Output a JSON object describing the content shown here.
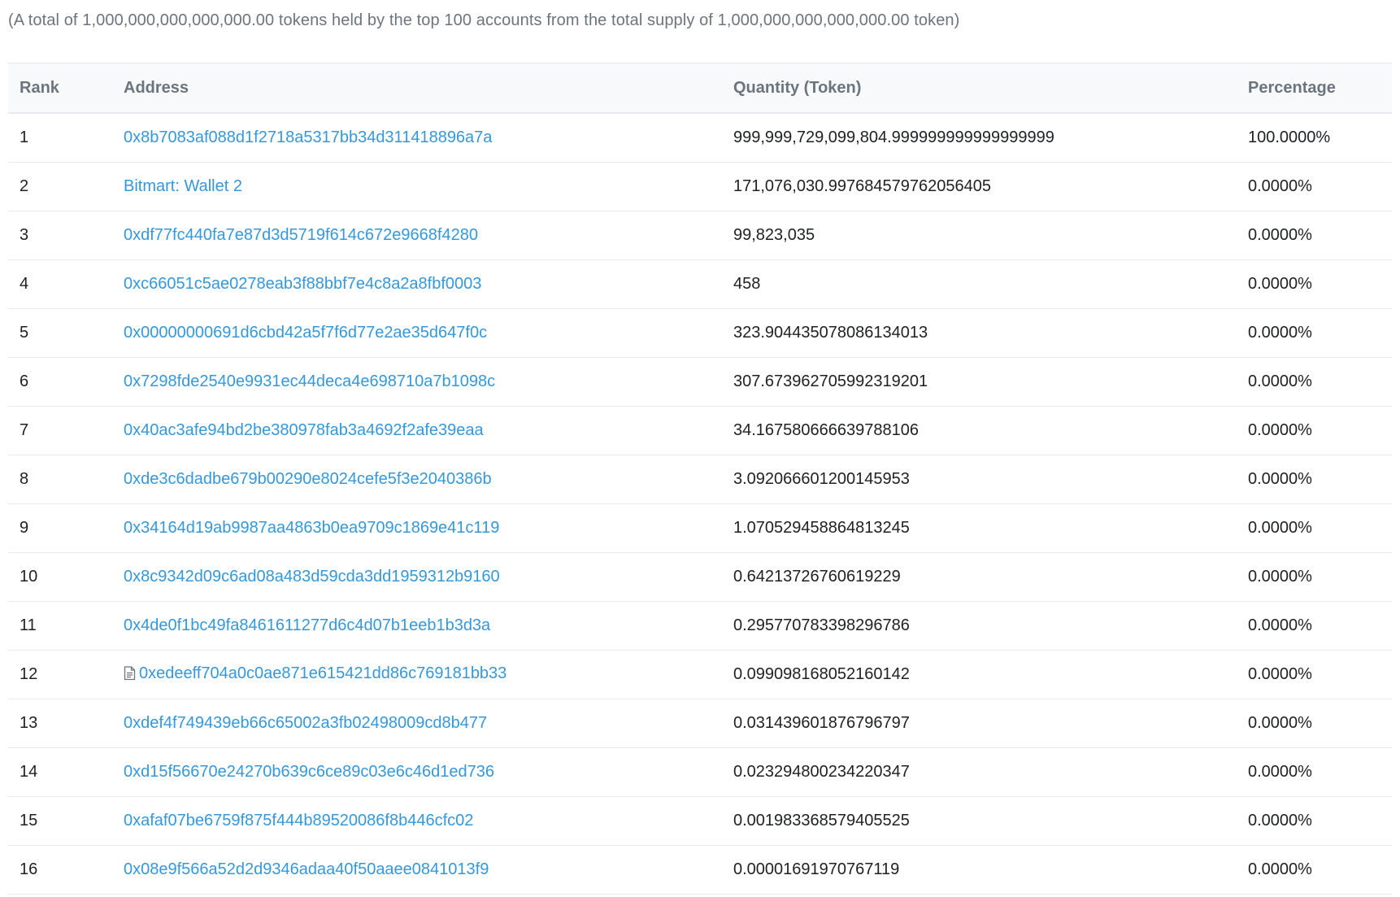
{
  "summary": "(A total of 1,000,000,000,000,000.00 tokens held by the top 100 accounts from the total supply of 1,000,000,000,000,000.00 token)",
  "table": {
    "headers": {
      "rank": "Rank",
      "address": "Address",
      "quantity": "Quantity (Token)",
      "percentage": "Percentage"
    },
    "rows": [
      {
        "rank": "1",
        "address": "0x8b7083af088d1f2718a5317bb34d311418896a7a",
        "quantity": "999,999,729,099,804.999999999999999999",
        "percentage": "100.0000%",
        "contract": false
      },
      {
        "rank": "2",
        "address": "Bitmart: Wallet 2",
        "quantity": "171,076,030.997684579762056405",
        "percentage": "0.0000%",
        "contract": false
      },
      {
        "rank": "3",
        "address": "0xdf77fc440fa7e87d3d5719f614c672e9668f4280",
        "quantity": "99,823,035",
        "percentage": "0.0000%",
        "contract": false
      },
      {
        "rank": "4",
        "address": "0xc66051c5ae0278eab3f88bbf7e4c8a2a8fbf0003",
        "quantity": "458",
        "percentage": "0.0000%",
        "contract": false
      },
      {
        "rank": "5",
        "address": "0x00000000691d6cbd42a5f7f6d77e2ae35d647f0c",
        "quantity": "323.904435078086134013",
        "percentage": "0.0000%",
        "contract": false
      },
      {
        "rank": "6",
        "address": "0x7298fde2540e9931ec44deca4e698710a7b1098c",
        "quantity": "307.673962705992319201",
        "percentage": "0.0000%",
        "contract": false
      },
      {
        "rank": "7",
        "address": "0x40ac3afe94bd2be380978fab3a4692f2afe39eaa",
        "quantity": "34.167580666639788106",
        "percentage": "0.0000%",
        "contract": false
      },
      {
        "rank": "8",
        "address": "0xde3c6dadbe679b00290e8024cefe5f3e2040386b",
        "quantity": "3.092066601200145953",
        "percentage": "0.0000%",
        "contract": false
      },
      {
        "rank": "9",
        "address": "0x34164d19ab9987aa4863b0ea9709c1869e41c119",
        "quantity": "1.070529458864813245",
        "percentage": "0.0000%",
        "contract": false
      },
      {
        "rank": "10",
        "address": "0x8c9342d09c6ad08a483d59cda3dd1959312b9160",
        "quantity": "0.64213726760619229",
        "percentage": "0.0000%",
        "contract": false
      },
      {
        "rank": "11",
        "address": "0x4de0f1bc49fa8461611277d6c4d07b1eeb1b3d3a",
        "quantity": "0.295770783398296786",
        "percentage": "0.0000%",
        "contract": false
      },
      {
        "rank": "12",
        "address": "0xedeeff704a0c0ae871e615421dd86c769181bb33",
        "quantity": "0.099098168052160142",
        "percentage": "0.0000%",
        "contract": true
      },
      {
        "rank": "13",
        "address": "0xdef4f749439eb66c65002a3fb02498009cd8b477",
        "quantity": "0.031439601876796797",
        "percentage": "0.0000%",
        "contract": false
      },
      {
        "rank": "14",
        "address": "0xd15f56670e24270b639c6ce89c03e6c46d1ed736",
        "quantity": "0.023294800234220347",
        "percentage": "0.0000%",
        "contract": false
      },
      {
        "rank": "15",
        "address": "0xafaf07be6759f875f444b89520086f8b446cfc02",
        "quantity": "0.001983368579405525",
        "percentage": "0.0000%",
        "contract": false
      },
      {
        "rank": "16",
        "address": "0x08e9f566a52d2d9346adaa40f50aaee0841013f9",
        "quantity": "0.00001691970767119",
        "percentage": "0.0000%",
        "contract": false
      }
    ]
  },
  "colors": {
    "link": "#3498db",
    "muted": "#6c757e",
    "text": "#1e2022",
    "border": "#e7eaf3",
    "header_bg": "#f8f9fa"
  },
  "icons": {
    "contract": "file-document-icon"
  }
}
